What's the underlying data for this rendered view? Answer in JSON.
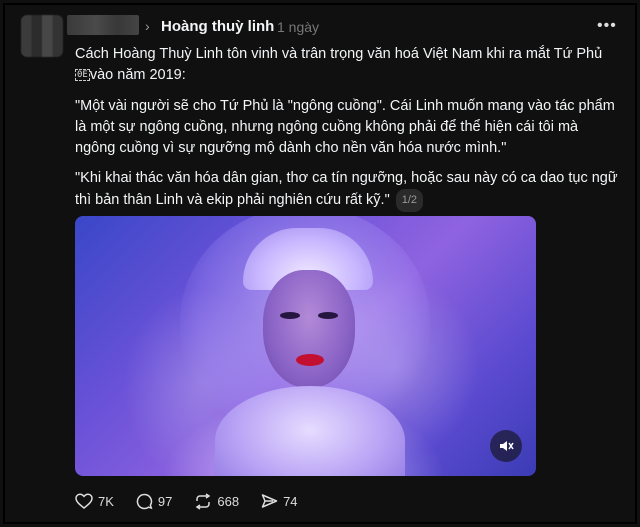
{
  "post": {
    "author": "Hoàng thuỳ linh",
    "time": "1 ngày",
    "more_label": "•••",
    "paragraph1_before": "Cách Hoàng Thuỳ Linh tôn vinh và trân trọng văn hoá Việt Nam khi ra mắt Tứ Phủ",
    "paragraph1_glyph": "0E",
    "paragraph1_after": "vào năm 2019:",
    "paragraph2": "\"Một vài người sẽ cho Tứ Phủ là \"ngông cuồng\". Cái Linh muốn mang vào tác phẩm là một sự ngông cuồng, nhưng ngông cuồng không phải để thể hiện cái tôi mà ngông cuồng vì sự ngưỡng mộ dành cho nền văn hóa nước mình.\"",
    "paragraph3": "\"Khi khai thác văn hóa dân gian, thơ ca tín ngưỡng, hoặc sau này có ca dao tục ngữ thì bản thân Linh và ekip phải nghiên cứu rất kỹ.\"",
    "pager": "1/2"
  },
  "actions": {
    "likes": "7K",
    "comments": "97",
    "reposts": "668",
    "shares": "74"
  },
  "icons": [
    "chevron-right-icon",
    "more-icon",
    "mute-icon",
    "heart-icon",
    "comment-icon",
    "repost-icon",
    "share-icon"
  ],
  "colors": {
    "background": "#101010",
    "text": "#f3f5f7",
    "muted": "#777777",
    "lips": "#c41030"
  }
}
